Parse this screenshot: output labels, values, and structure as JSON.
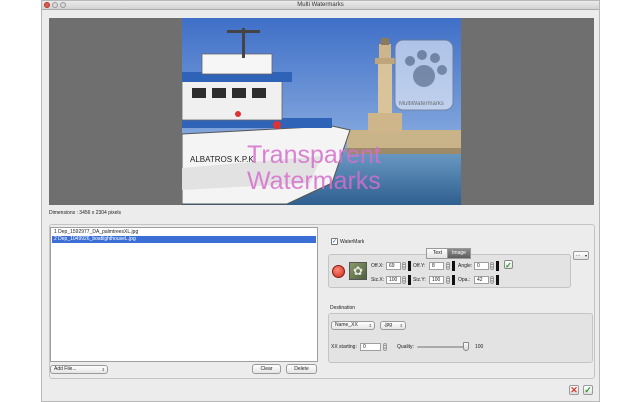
{
  "window": {
    "title": "Multi Watermarks"
  },
  "preview": {
    "watermark_text_line1": "Transparent",
    "watermark_text_line2": "Watermarks",
    "boat_name": "ALBATROS K.P.K",
    "logo_caption": "MultiWatermarks",
    "dimensions": "Dimensions : 3456 x 2304 pixels"
  },
  "files": {
    "items": [
      {
        "label": "1 Dep_1592977_DA_palmtreesXL.jpg",
        "selected": false
      },
      {
        "label": "2 Dep_1049926_boatlighthouseL.jpg",
        "selected": true
      }
    ],
    "add_file_label": "Add File...",
    "clear_label": "Clear",
    "delete_label": "Delete"
  },
  "watermark": {
    "checkbox_label": "WaterMark",
    "checked": true,
    "tabs": [
      "Text",
      "Image"
    ],
    "active_tab": "Image",
    "more_button_label": "...",
    "offx_label": "Off.X:",
    "offx_value": "69",
    "offy_label": "Off.Y:",
    "offy_value": "8",
    "angle_label": "Angle:",
    "angle_value": "0",
    "sizx_label": "Siz.X:",
    "sizx_value": "100",
    "sizy_label": "Siz.Y:",
    "sizy_value": "100",
    "opa_label": "Opa.:",
    "opa_value": "42"
  },
  "destination": {
    "title": "Destination",
    "name_value": "Name_XX",
    "format_value": ".jpg",
    "xx_starting_label": "XX starting:",
    "xx_starting_value": "0",
    "quality_label": "Quality:",
    "quality_value": "100",
    "quality_level": 1.0
  },
  "colors": {
    "selection": "#3b6fd6",
    "watermark_text": "#d56fcc",
    "cancel": "#d63b2a",
    "ok": "#2a9a2a"
  }
}
